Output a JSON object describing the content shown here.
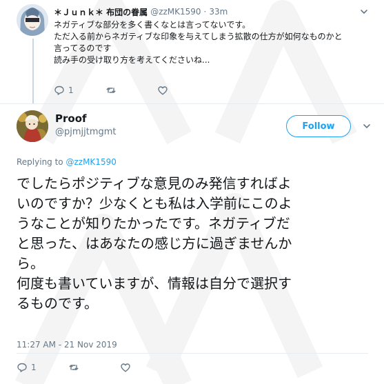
{
  "reply_tweet": {
    "name": "＊Ｊｕｎｋ＊ 布団の眷属",
    "handle": "@zzMK1590",
    "time": "33m",
    "lines": [
      "ネガティブな部分を多く書くなとは言ってないです。",
      "ただ入る前からネガティブな印象を与えてしまう拡散の仕方が如何なものかと",
      "言ってるのです",
      "読み手の受け取り方を考えてくださいね..."
    ],
    "reply_count": "1",
    "icons": [
      "reply-icon",
      "retweet-icon",
      "like-icon",
      "chevron-down-icon"
    ]
  },
  "main_tweet": {
    "name": "Proof",
    "handle": "@pjmjjtmgmt",
    "follow_label": "Follow",
    "replying_prefix": "Replying to",
    "replying_to": "@zzMK1590",
    "text_lines": [
      "でしたらポジティブな意見のみ発信すればよ",
      "いのですか？少なくとも私は入学前にこのよ",
      "うなことが知りたかったです。ネガティブだ",
      "と思った、はあなたの感じ方に過ぎませんか",
      "ら。",
      "何度も書いていますが、情報は自分で選択す",
      "るものです。"
    ],
    "timestamp": "11:27 AM - 21 Nov 2019",
    "reply_count": "1",
    "icons": [
      "reply-icon",
      "retweet-icon",
      "like-icon",
      "chevron-down-icon"
    ]
  },
  "colors": {
    "accent": "#1da1f2",
    "text": "#14171a",
    "secondary": "#657786",
    "divider": "#e6ecf0"
  }
}
